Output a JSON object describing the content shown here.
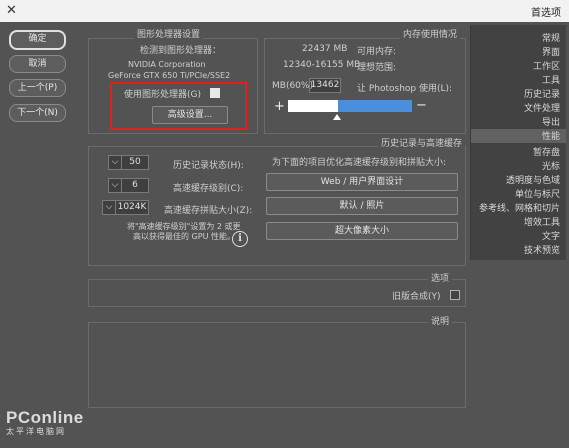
{
  "window": {
    "title": "首选项",
    "close_glyph": "✕"
  },
  "buttons": {
    "ok": "确定",
    "cancel": "取消",
    "prev": "上一个(P)",
    "next": "下一个(N)"
  },
  "sidebar": {
    "items": [
      {
        "label": "常规",
        "selected": false
      },
      {
        "label": "界面",
        "selected": false
      },
      {
        "label": "工作区",
        "selected": false
      },
      {
        "label": "工具",
        "selected": false
      },
      {
        "label": "历史记录",
        "selected": false
      },
      {
        "label": "文件处理",
        "selected": false
      },
      {
        "label": "导出",
        "selected": false
      },
      {
        "label": "性能",
        "selected": true
      },
      {
        "label": "暂存盘",
        "selected": false
      },
      {
        "label": "光标",
        "selected": false
      },
      {
        "label": "透明度与色域",
        "selected": false
      },
      {
        "label": "单位与标尺",
        "selected": false
      },
      {
        "label": "参考线、网格和切片",
        "selected": false
      },
      {
        "label": "增效工具",
        "selected": false
      },
      {
        "label": "文字",
        "selected": false
      },
      {
        "label": "技术预览",
        "selected": false
      }
    ]
  },
  "gpu": {
    "group_title": "图形处理器设置",
    "detected_label": "检测到图形处理器：",
    "vendor": "NVIDIA Corporation",
    "model": "GeForce GTX 650 Ti/PCIe/SSE2",
    "use_gpu_label": "使用图形处理器(G)",
    "use_gpu_checked": true,
    "advanced_button": "高级设置..."
  },
  "memory": {
    "group_title": "内存使用情况",
    "available_label": "可用内存:",
    "available_value": "22437 MB",
    "ideal_label": "理想范围:",
    "ideal_value": "12340-16155 MB",
    "let_label": "让 Photoshop 使用(L):",
    "let_value": "13462",
    "unit_label": "MB(60%)",
    "slider_percent": 60,
    "plus": "+",
    "minus": "−"
  },
  "history": {
    "group_title": "历史记录与高速缓存",
    "optimize_label": "为下面的项目优化高速缓存级别和拼贴大小:",
    "btn_web": "Web / 用户界面设计",
    "btn_default": "默认 / 照片",
    "btn_huge": "超大像素大小",
    "states_label": "历史记录状态(H):",
    "states_value": "50",
    "levels_label": "高速缓存级别(C):",
    "levels_value": "6",
    "tile_label": "高速缓存拼贴大小(Z):",
    "tile_value": "1024K",
    "note_line1": "将\"高速缓存级别\"设置为 2 或更",
    "note_line2": "高以获得最佳的 GPU 性能。",
    "info_glyph": "i"
  },
  "options": {
    "group_title": "选项",
    "legacy_label": "旧版合成(Y)",
    "legacy_checked": false
  },
  "description": {
    "group_title": "说明"
  },
  "watermark": {
    "brand": "PConline",
    "sub": "太平洋电脑网"
  }
}
